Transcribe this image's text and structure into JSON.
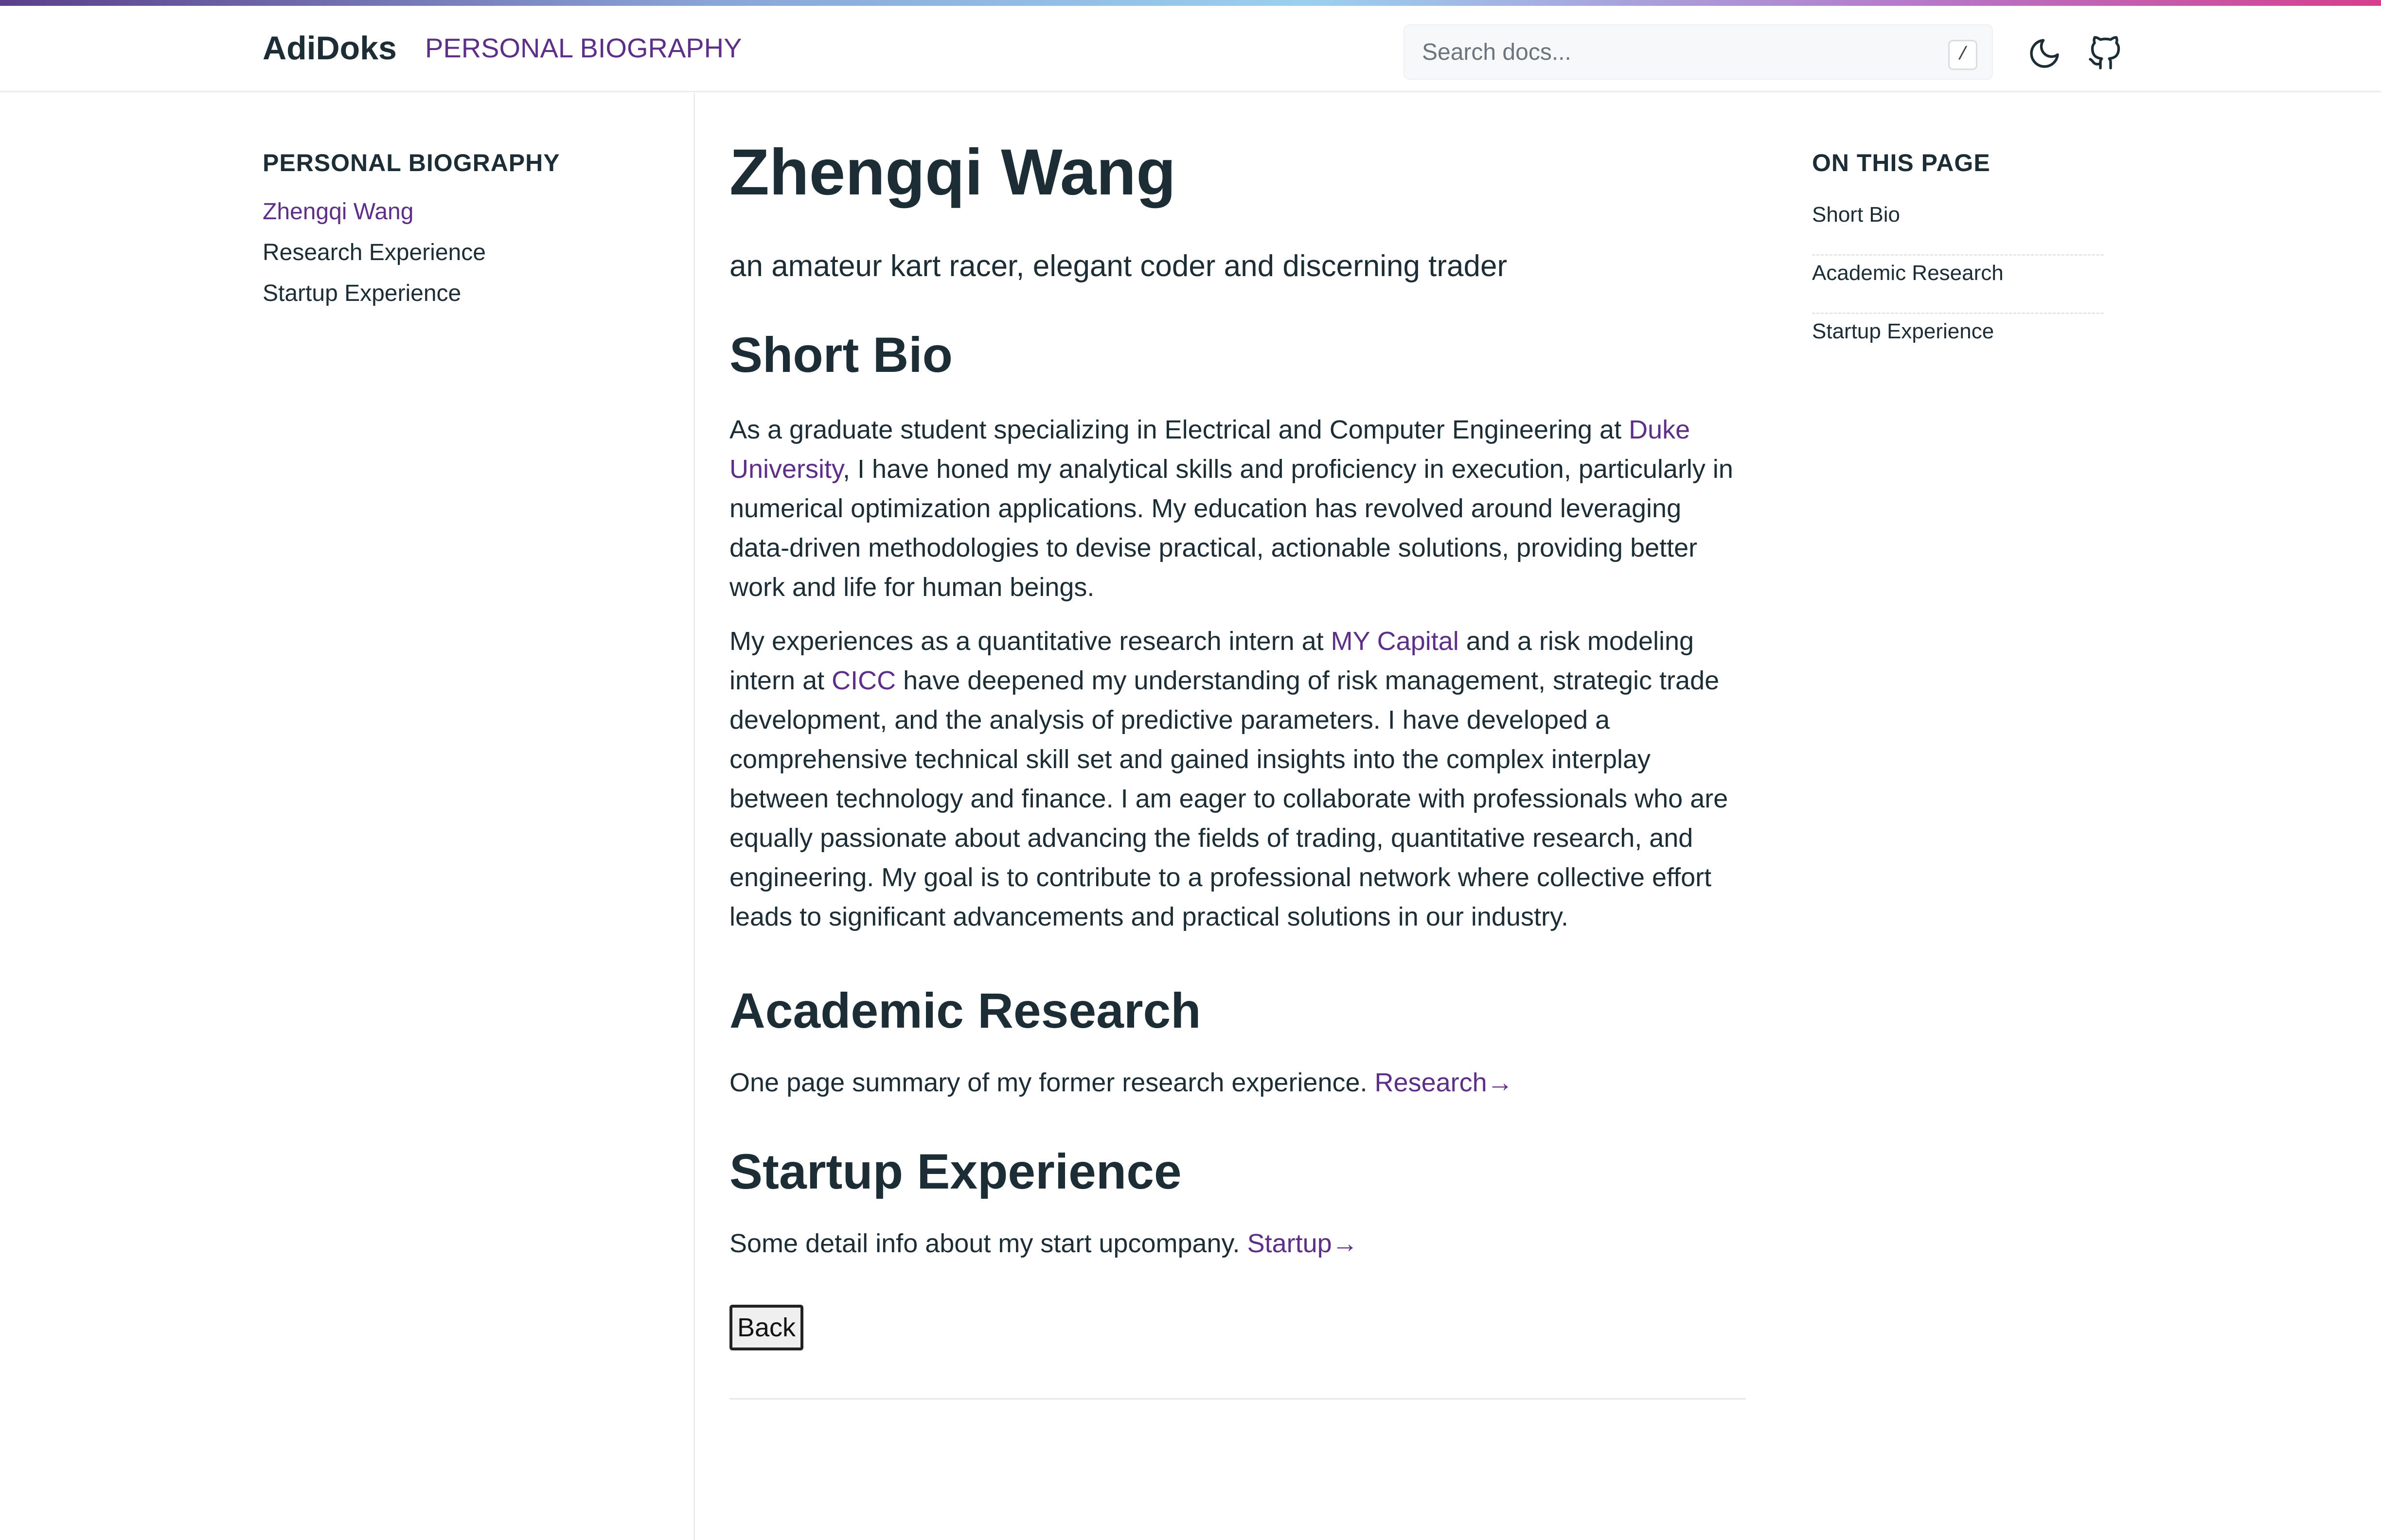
{
  "header": {
    "brand": "AdiDoks",
    "nav_link": "PERSONAL BIOGRAPHY",
    "search_placeholder": "Search docs...",
    "search_shortcut": "/",
    "theme_icon": "moon-icon",
    "repo_icon": "github-icon"
  },
  "sidebar": {
    "title": "PERSONAL BIOGRAPHY",
    "items": [
      {
        "label": "Zhengqi Wang",
        "active": true
      },
      {
        "label": "Research Experience",
        "active": false
      },
      {
        "label": "Startup Experience",
        "active": false
      }
    ]
  },
  "toc": {
    "title": "ON THIS PAGE",
    "items": [
      {
        "label": "Short Bio"
      },
      {
        "label": "Academic Research"
      },
      {
        "label": "Startup Experience"
      }
    ]
  },
  "main": {
    "title": "Zhengqi Wang",
    "lead": "an amateur kart racer, elegant coder and discerning trader",
    "short_bio": {
      "heading": "Short Bio",
      "p1_a": "As a graduate student specializing in Electrical and Computer Engineering at ",
      "p1_link": "Duke University",
      "p1_b": ", I have honed my analytical skills and proficiency in execution, particularly in numerical optimization applications. My education has revolved around leveraging data-driven methodologies to devise practical, actionable solutions, providing better work and life for human beings.",
      "p2_a": "My experiences as a quantitative research intern at ",
      "p2_link1": "MY Capital",
      "p2_b": " and a risk modeling intern at ",
      "p2_link2": "CICC",
      "p2_c": " have deepened my understanding of risk management, strategic trade development, and the analysis of predictive parameters. I have developed a comprehensive technical skill set and gained insights into the complex interplay between technology and finance. I am eager to collaborate with professionals who are equally passionate about advancing the fields of trading, quantitative research, and engineering. My goal is to contribute to a professional network where collective effort leads to significant advancements and practical solutions in our industry."
    },
    "academic": {
      "heading": "Academic Research",
      "text": "One page summary of my former research experience. ",
      "link": "Research→"
    },
    "startup": {
      "heading": "Startup Experience",
      "text": "Some detail info about my start upcompany. ",
      "link": "Startup→"
    },
    "back_label": "Back"
  },
  "colors": {
    "accent": "#5d2f86",
    "text": "#1d2d35",
    "border": "#eaecef"
  }
}
